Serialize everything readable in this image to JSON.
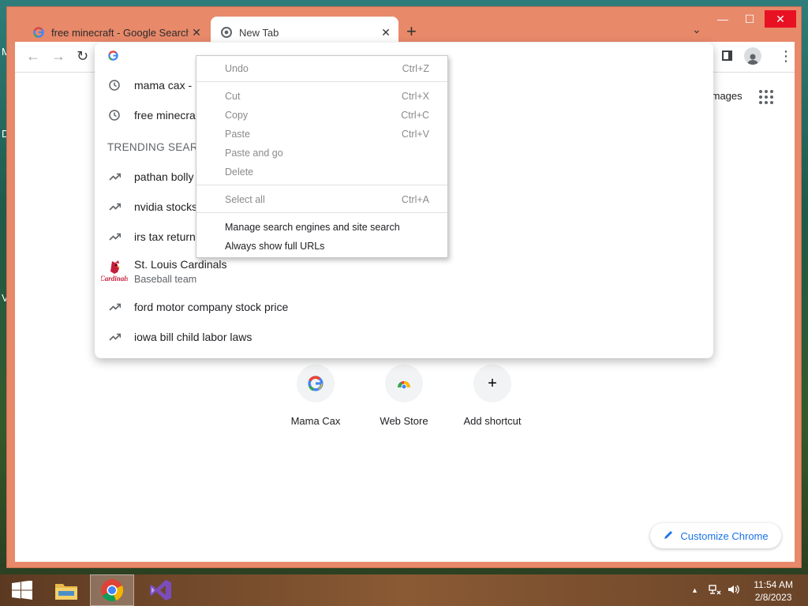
{
  "desktop": {
    "letters": [
      "M",
      "D",
      "V"
    ]
  },
  "window": {
    "controls": {
      "minimize": "—",
      "maximize": "☐",
      "close": "✕"
    },
    "tabs": [
      {
        "title": "free minecraft - Google Search",
        "close": "✕"
      },
      {
        "title": "New Tab",
        "close": "✕"
      }
    ],
    "new_tab": "+",
    "tab_search": "⌄"
  },
  "toolbar": {
    "back": "←",
    "forward": "→",
    "reload": "↻",
    "menu": "⋮"
  },
  "page": {
    "images_link": "Images"
  },
  "dropdown": {
    "recent": [
      {
        "icon": "clock-icon",
        "text": "mama cax -"
      },
      {
        "icon": "clock-icon",
        "text": "free minecra"
      }
    ],
    "trending_header": "TRENDING SEARC",
    "trending": [
      {
        "icon": "trending-icon",
        "text": "pathan bolly"
      },
      {
        "icon": "trending-icon",
        "text": "nvidia stocks"
      },
      {
        "icon": "trending-icon",
        "text": "irs tax return"
      }
    ],
    "entity": {
      "title": "St. Louis Cardinals",
      "subtitle": "Baseball team",
      "logo_text": "Cardinals"
    },
    "more": [
      {
        "icon": "trending-icon",
        "text": "ford motor company stock price"
      },
      {
        "icon": "trending-icon",
        "text": "iowa bill child labor laws"
      }
    ]
  },
  "context_menu": {
    "undo": {
      "label": "Undo",
      "key": "Ctrl+Z"
    },
    "cut": {
      "label": "Cut",
      "key": "Ctrl+X"
    },
    "copy": {
      "label": "Copy",
      "key": "Ctrl+C"
    },
    "paste": {
      "label": "Paste",
      "key": "Ctrl+V"
    },
    "paste_go": {
      "label": "Paste and go"
    },
    "delete": {
      "label": "Delete"
    },
    "select_all": {
      "label": "Select all",
      "key": "Ctrl+A"
    },
    "manage": {
      "label": "Manage search engines and site search"
    },
    "full_urls": {
      "label": "Always show full URLs"
    }
  },
  "shortcuts": [
    {
      "label": "Mama Cax",
      "icon": "google-icon"
    },
    {
      "label": "Web Store",
      "icon": "webstore-icon"
    },
    {
      "label": "Add shortcut",
      "icon": "plus-icon",
      "glyph": "+"
    }
  ],
  "customize": {
    "label": "Customize Chrome"
  },
  "taskbar": {
    "clock": {
      "time": "11:54 AM",
      "date": "2/8/2023"
    },
    "tray_arrow": "▲"
  }
}
